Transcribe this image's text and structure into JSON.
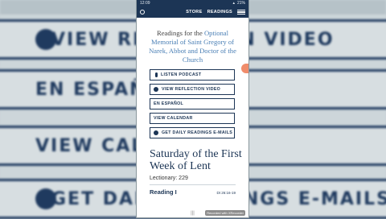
{
  "status": {
    "time": "12:09",
    "battery": "21%"
  },
  "nav": {
    "store": "STORE",
    "readings": "READINGS"
  },
  "intro": {
    "prefix": "Readings for the ",
    "memorial": "Optional Memorial of Saint Gregory of Narek, Abbot and Doctor of the Church"
  },
  "buttons": [
    {
      "label": "LISTEN PODCAST",
      "icon": "microphone-icon"
    },
    {
      "label": "VIEW REFLECTION VIDEO",
      "icon": "play-icon"
    },
    {
      "label": "EN ESPAÑOL",
      "icon": ""
    },
    {
      "label": "VIEW CALENDAR",
      "icon": ""
    },
    {
      "label": "GET DAILY READINGS E-MAILS",
      "icon": "email-icon"
    }
  ],
  "day": {
    "title": "Saturday of the First Week of Lent",
    "lectionary": "Lectionary: 229"
  },
  "reading1": {
    "title": "Reading I",
    "ref": "Dt 26:16-19"
  },
  "background": {
    "row1": "VIEW REFLECTION VIDEO",
    "row2": "EN ESPAÑOL",
    "row3": "VIEW CALENDAR",
    "row4": "GET DAILY READINGS E-MAILS"
  },
  "watermark": "Recorded with XRecorder",
  "colors": {
    "navy": "#1c3555",
    "link": "#4a7fb5",
    "accent": "#f08c6b"
  }
}
